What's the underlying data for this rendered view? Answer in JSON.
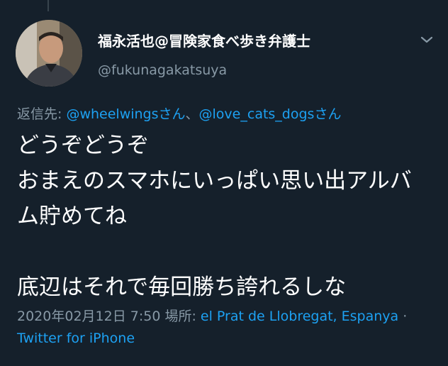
{
  "tweet": {
    "display_name": "福永活也@冒険家食べ歩き弁護士",
    "handle": "@fukunagakatsuya",
    "reply_prefix": "返信先: ",
    "reply_mentions": [
      "@wheelwingsさん",
      "@love_cats_dogsさん"
    ],
    "reply_separator": "、",
    "body_lines": [
      "どうぞどうぞ",
      "おまえのスマホにいっぱい思い出アルバ",
      "ム貯めてね",
      "",
      "底辺はそれで毎回勝ち誇れるしな"
    ],
    "timestamp": "2020年02月12日 7:50",
    "location_prefix": " 場所: ",
    "location": "el Prat de Llobregat, Espanya",
    "dot": " ·",
    "source": "Twitter for iPhone"
  },
  "icons": {
    "avatar": "profile-photo",
    "caret": "chevron-down-icon"
  },
  "colors": {
    "background": "#15202b",
    "text": "#ffffff",
    "secondary": "#8899a6",
    "link": "#1da1f2"
  }
}
